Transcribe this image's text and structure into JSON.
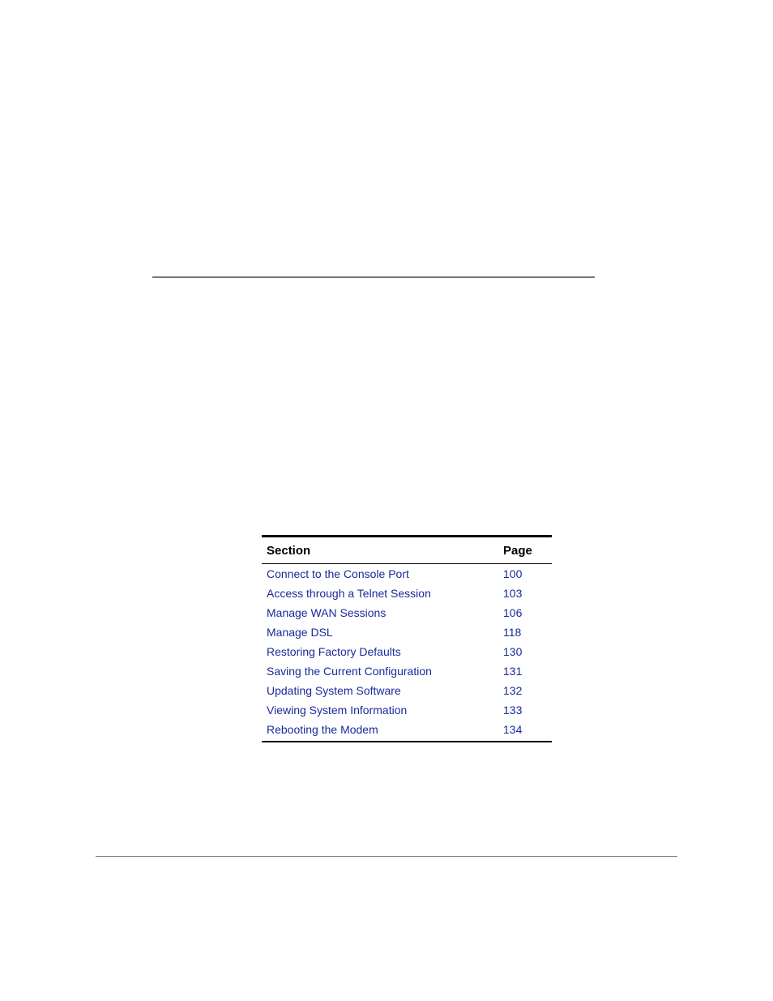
{
  "table": {
    "headers": {
      "section": "Section",
      "page": "Page"
    },
    "rows": [
      {
        "section": "Connect to the Console Port",
        "page": "100"
      },
      {
        "section": "Access through a Telnet Session",
        "page": "103"
      },
      {
        "section": "Manage WAN Sessions",
        "page": "106"
      },
      {
        "section": "Manage DSL",
        "page": "118"
      },
      {
        "section": "Restoring Factory Defaults",
        "page": "130"
      },
      {
        "section": "Saving the Current Configuration",
        "page": "131"
      },
      {
        "section": "Updating System Software",
        "page": "132"
      },
      {
        "section": "Viewing System Information",
        "page": "133"
      },
      {
        "section": "Rebooting the Modem",
        "page": "134"
      }
    ]
  },
  "colors": {
    "link": "#1a2a99",
    "rule": "#777777"
  }
}
